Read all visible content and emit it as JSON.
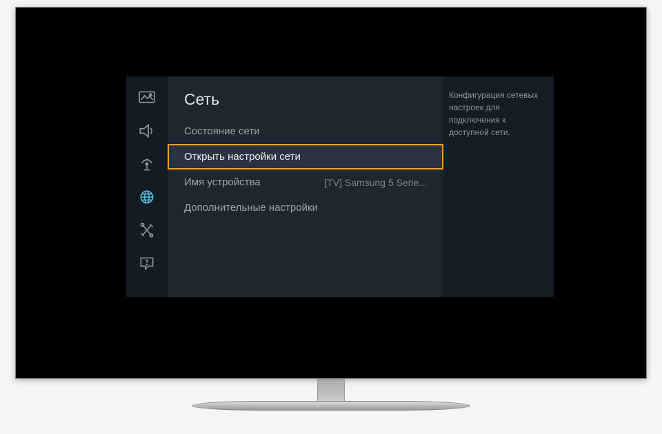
{
  "sidebar": {
    "items": [
      {
        "name": "picture-icon"
      },
      {
        "name": "sound-icon"
      },
      {
        "name": "broadcast-icon"
      },
      {
        "name": "network-icon",
        "active": true
      },
      {
        "name": "tools-icon"
      },
      {
        "name": "support-icon"
      }
    ]
  },
  "menu": {
    "title": "Сеть",
    "items": [
      {
        "label": "Состояние сети",
        "value": ""
      },
      {
        "label": "Открыть настройки сети",
        "value": "",
        "selected": true
      },
      {
        "label": "Имя устройства",
        "value": "[TV] Samsung 5 Serie..."
      },
      {
        "label": "Дополнительные настройки",
        "value": ""
      }
    ]
  },
  "help": {
    "text": "Конфигурация сетевых настроек для подключения к доступной сети."
  }
}
